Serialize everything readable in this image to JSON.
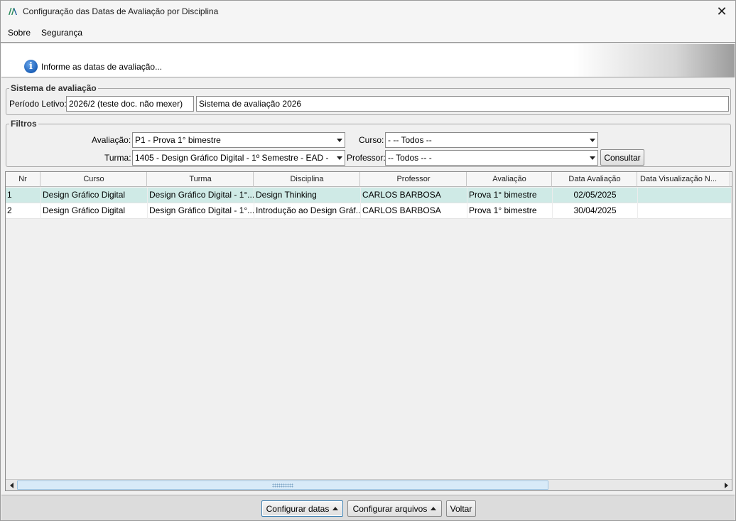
{
  "window": {
    "title": "Configuração das Datas de Avaliação por Disciplina",
    "close_label": "✕"
  },
  "menu": {
    "items": [
      "Sobre",
      "Segurança"
    ]
  },
  "info": {
    "message": "Informe as datas de avaliação..."
  },
  "sistema": {
    "legend": "Sistema de avaliação",
    "periodo_label": "Período Letivo:",
    "periodo_value": "2026/2 (teste doc. não mexer)",
    "sistema_value": "Sistema de avaliação 2026"
  },
  "filtros": {
    "legend": "Filtros",
    "avaliacao_label": "Avaliação:",
    "avaliacao_value": "P1 - Prova 1° bimestre",
    "curso_label": "Curso:",
    "curso_value": "- -- Todos --",
    "turma_label": "Turma:",
    "turma_value": "1405 - Design Gráfico Digital - 1º Semestre - EAD -",
    "professor_label": "Professor:",
    "professor_value": "-- Todos -- -",
    "consultar_label": "Consultar"
  },
  "grid": {
    "columns": [
      "Nr",
      "Curso",
      "Turma",
      "Disciplina",
      "Professor",
      "Avaliação",
      "Data Avaliação",
      "Data Visualização N..."
    ],
    "rows": [
      [
        "1",
        "Design Gráfico Digital",
        "Design Gráfico Digital - 1°...",
        "Design Thinking",
        "CARLOS BARBOSA",
        "Prova 1° bimestre",
        "02/05/2025",
        ""
      ],
      [
        "2",
        "Design Gráfico Digital",
        "Design Gráfico Digital - 1°...",
        "Introdução ao Design Gráf...",
        "CARLOS BARBOSA",
        "Prova 1° bimestre",
        "30/04/2025",
        ""
      ]
    ],
    "selected_row": 0
  },
  "actions": {
    "configurar_datas": "Configurar datas",
    "configurar_arquivos": "Configurar arquivos",
    "voltar": "Voltar"
  }
}
